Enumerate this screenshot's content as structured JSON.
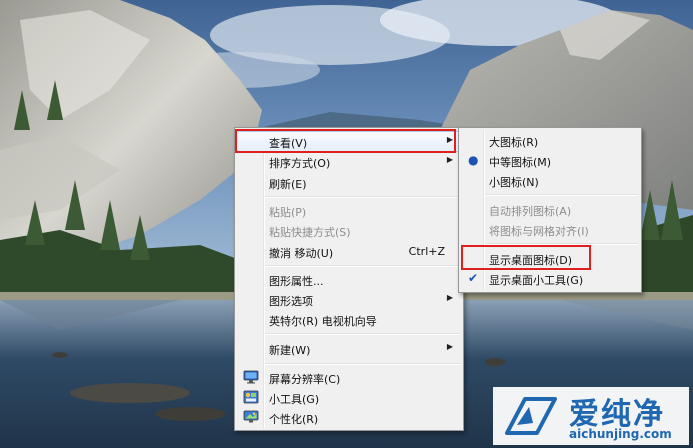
{
  "context_menu": {
    "items": [
      {
        "label": "查看(V)",
        "arrow": "▶"
      },
      {
        "label": "排序方式(O)",
        "arrow": "▶"
      },
      {
        "label": "刷新(E)"
      },
      {
        "label": "粘贴(P)"
      },
      {
        "label": "粘贴快捷方式(S)"
      },
      {
        "label": "撤消 移动(U)",
        "shortcut": "Ctrl+Z"
      },
      {
        "label": "图形属性..."
      },
      {
        "label": "图形选项",
        "arrow": "▶"
      },
      {
        "label": "英特尔(R) 电视机向导"
      },
      {
        "label": "新建(W)",
        "arrow": "▶"
      },
      {
        "label": "屏幕分辨率(C)"
      },
      {
        "label": "小工具(G)"
      },
      {
        "label": "个性化(R)"
      }
    ]
  },
  "view_submenu": {
    "items": [
      {
        "label": "大图标(R)"
      },
      {
        "label": "中等图标(M)",
        "mark": "●"
      },
      {
        "label": "小图标(N)"
      },
      {
        "label": "自动排列图标(A)"
      },
      {
        "label": "将图标与网格对齐(I)"
      },
      {
        "label": "显示桌面图标(D)"
      },
      {
        "label": "显示桌面小工具(G)",
        "mark": "✔"
      }
    ]
  },
  "watermark": {
    "name": "爱纯净",
    "url": "aichunjing.com"
  },
  "colors": {
    "highlight_box": "#e0201c",
    "watermark_blue": "#1f67b1"
  }
}
